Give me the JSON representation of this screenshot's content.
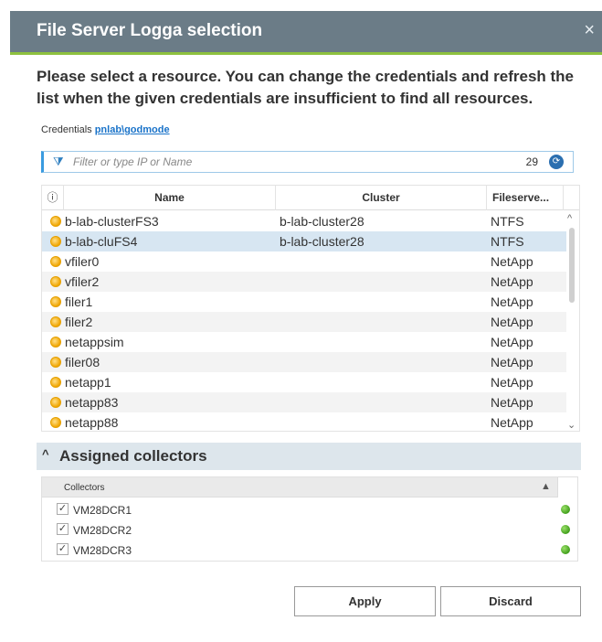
{
  "dialog": {
    "title": "File Server Logga selection",
    "close_glyph": "×"
  },
  "intro_text": "Please select a resource. You can change the credentials and refresh the list when the given credentials are insufficient to find all resources.",
  "credentials": {
    "label": "Credentials",
    "value": "pnlab\\godmode"
  },
  "filter": {
    "placeholder": "Filter or type IP or Name",
    "value": "",
    "count": "29"
  },
  "resource_table": {
    "columns": [
      "ⓘ",
      "Name",
      "Cluster",
      "Fileserve..."
    ],
    "selected_index": 1,
    "rows": [
      {
        "name": "b-lab-clusterFS3",
        "cluster": "b-lab-cluster28",
        "fileserver": "NTFS"
      },
      {
        "name": "b-lab-cluFS4",
        "cluster": "b-lab-cluster28",
        "fileserver": "NTFS"
      },
      {
        "name": "vfiler0",
        "cluster": "",
        "fileserver": "NetApp"
      },
      {
        "name": "vfiler2",
        "cluster": "",
        "fileserver": "NetApp"
      },
      {
        "name": "filer1",
        "cluster": "",
        "fileserver": "NetApp"
      },
      {
        "name": "filer2",
        "cluster": "",
        "fileserver": "NetApp"
      },
      {
        "name": "netappsim",
        "cluster": "",
        "fileserver": "NetApp"
      },
      {
        "name": "filer08",
        "cluster": "",
        "fileserver": "NetApp"
      },
      {
        "name": "netapp1",
        "cluster": "",
        "fileserver": "NetApp"
      },
      {
        "name": "netapp83",
        "cluster": "",
        "fileserver": "NetApp"
      },
      {
        "name": "netapp88",
        "cluster": "",
        "fileserver": "NetApp"
      }
    ]
  },
  "assigned_collectors": {
    "section_label": "Assigned collectors",
    "column_label": "Collectors",
    "rows": [
      {
        "name": "VM28DCR1",
        "checked": true,
        "status_color": "#3a9a15"
      },
      {
        "name": "VM28DCR2",
        "checked": true,
        "status_color": "#3a9a15"
      },
      {
        "name": "VM28DCR3",
        "checked": true,
        "status_color": "#3a9a15"
      }
    ]
  },
  "buttons": {
    "apply": "Apply",
    "discard": "Discard"
  },
  "colors": {
    "titlebar": "#6b7c87",
    "accent": "#8ec13f",
    "link": "#1a73c9",
    "selected_row": "#d7e6f2"
  }
}
